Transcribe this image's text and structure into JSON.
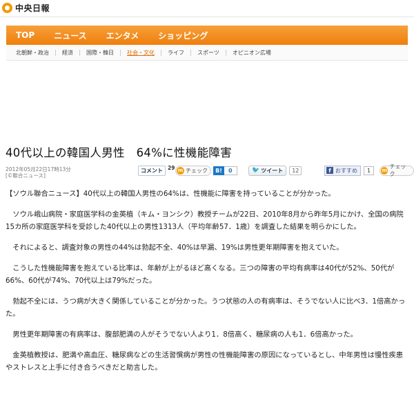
{
  "header": {
    "logo_text": "中央日報"
  },
  "nav": {
    "items": [
      "TOP",
      "ニュース",
      "エンタメ",
      "ショッピング"
    ]
  },
  "subnav": {
    "items": [
      "北朝鮮・政治",
      "経済",
      "国際・韓日",
      "社会・文化",
      "ライフ",
      "スポーツ",
      "オピニオン広場"
    ],
    "active": "社会・文化"
  },
  "article": {
    "headline": "40代以上の韓国人男性　64%に性機能障害",
    "date": "2012年05月22日17時13分",
    "source": "[©聯合ニュース]",
    "paragraphs": [
      "【ソウル聯合ニュース】40代以上の韓国人男性の64%は、性機能に障害を持っていることが分かった。",
      "ソウル峨山病院・家庭医学科の金英植（キム・ヨンシク）教授チームが22日、2010年8月から昨年5月にかけ、全国の病院15カ所の家庭医学科を受診した40代以上の男性1313人（平均年齢57．1歳）を調査した結果を明らかにした。",
      "それによると、調査対象の男性の44%は勃起不全、40%は早漏、19%は男性更年期障害を抱えていた。",
      "こうした性機能障害を抱えている比率は、年齢が上がるほど高くなる。三つの障害の平均有病率は40代が52%、50代が66%、60代が74%、70代以上は79%だった。",
      "勃起不全には、うつ病が大きく関係していることが分かった。うつ状態の人の有病率は、そうでない人に比べ3．1倍高かった。",
      "男性更年期障害の有病率は、腹部肥満の人がそうでない人より1．8倍高く、糖尿病の人も1．6倍高かった。",
      "金英植教授は、肥満や高血圧、糖尿病などの生活習慣病が男性の性機能障害の原因になっているとし、中年男性は慢性疾患やストレスと上手に付き合うべきだと助言した。"
    ]
  },
  "social": {
    "comment_label": "コメント",
    "comment_count": "29",
    "check_label": "チェック",
    "hatena_label": "B!",
    "hatena_count": "0",
    "tweet_label": "ツイート",
    "tweet_count": "12",
    "fb_label": "おすすめ",
    "fb_icon": "f",
    "fb_count": "1"
  },
  "colors": {
    "nav_orange": "#f28a17",
    "active_link": "#e06d00"
  }
}
